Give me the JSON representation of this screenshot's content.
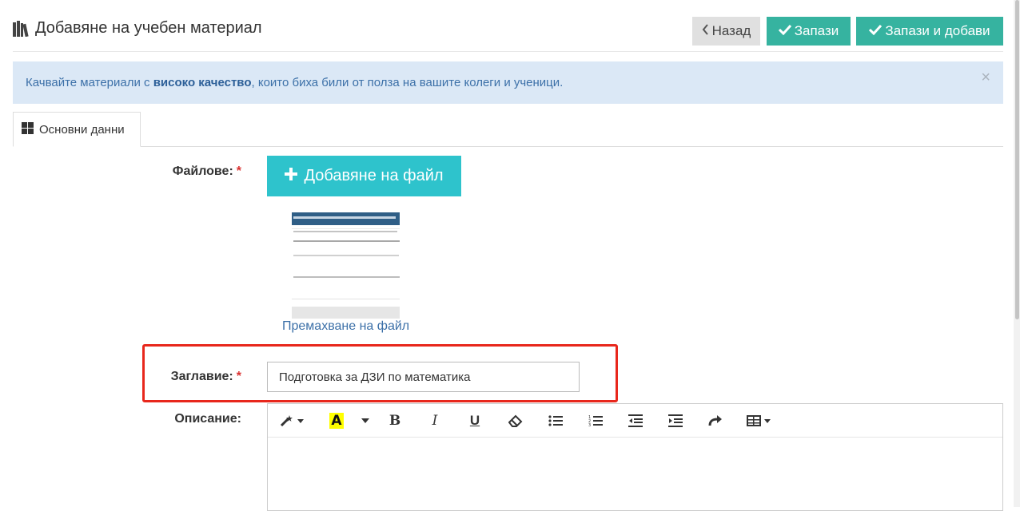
{
  "header": {
    "title": "Добавяне на учебен материал",
    "title_icon": "books-icon",
    "back_label": "Назад",
    "save_label": "Запази",
    "save_add_label": "Запази и добави"
  },
  "alert": {
    "text_before": "Качвайте материали с ",
    "text_bold": "високо качество",
    "text_after": ", които биха били от полза на вашите колеги и ученици.",
    "close": "×"
  },
  "tabs": [
    {
      "label": "Основни данни",
      "icon": "grid-icon"
    }
  ],
  "form": {
    "files_label": "Файлове:",
    "add_file_label": "Добавяне на файл",
    "remove_file_label": "Премахване на файл",
    "title_label": "Заглавие:",
    "title_value": "Подготовка за ДЗИ по математика",
    "description_label": "Описание:",
    "required_mark": "*"
  },
  "editor": {
    "tools": [
      "magic-wand-icon",
      "text-color-icon",
      "dropdown-icon",
      "bold-icon",
      "italic-icon",
      "underline-icon",
      "eraser-icon",
      "unordered-list-icon",
      "ordered-list-icon",
      "outdent-icon",
      "indent-icon",
      "redo-icon",
      "table-icon"
    ],
    "bold_glyph": "B",
    "italic_glyph": "I",
    "underline_glyph": "U",
    "color_glyph": "A"
  },
  "colors": {
    "accent": "#36b3a0",
    "add_file": "#2ec3cc",
    "alert_bg": "#dbe8f6",
    "highlight": "#e8271c",
    "required": "#d9302f"
  }
}
